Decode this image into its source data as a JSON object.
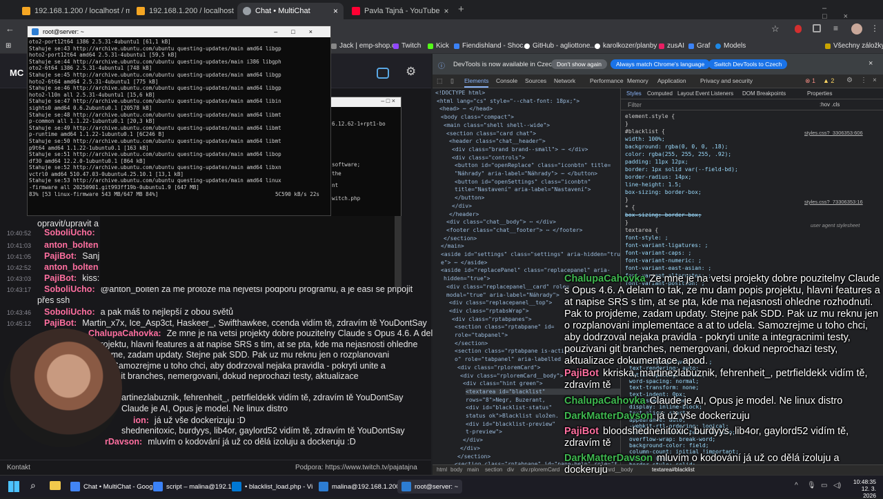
{
  "tabs": [
    {
      "label": "192.168.1.200 / localhost / mlu"
    },
    {
      "label": "192.168.1.200 / localhost / mlu"
    },
    {
      "label": "Chat • MultiChat"
    },
    {
      "label": "Pavla Tajná - YouTube"
    }
  ],
  "bookmarks": [
    "Jack | emp-shop.cz",
    "Twitch",
    "Kick",
    "Fiendishland - Shoc...",
    "GitHub - agliottone...",
    "karolkozer/planby",
    "zusAI",
    "Graf",
    "Models"
  ],
  "bookmarks_all": "Všechny záložky",
  "terminal": {
    "title": "root@server: ~",
    "lines": [
      "oto2-port12t64 i386 2.5.31-4ubuntu1 [61,1 kB]",
      "Stahuje se:43 http://archive.ubuntu.com/ubuntu questing-updates/main amd64 libgp",
      "hoto2-port12t64 amd64 2.5.31-4ubuntu1 [59,5 kB]",
      "Stahuje se:44 http://archive.ubuntu.com/ubuntu questing-updates/main i386 libgph",
      "oto2-6t64 i386 2.5.31-4ubuntu1 [748 kB]",
      "Stahuje se:45 http://archive.ubuntu.com/ubuntu questing-updates/main amd64 libgp",
      "hoto2-6t64 amd64 2.5.31-4ubuntu1 [775 kB]",
      "Stahuje se:46 http://archive.ubuntu.com/ubuntu questing-updates/main amd64 libgp",
      "hoto2-l10n all 2.5.31-4ubuntu1 [15,6 kB]",
      "Stahuje se:47 http://archive.ubuntu.com/ubuntu questing-updates/main amd64 libin",
      "sights0 amd64 0.6.2ubuntu0.1 [20578 kB]",
      "Stahuje se:48 http://archive.ubuntu.com/ubuntu questing-updates/main amd64 libmt",
      "p-common all 1.1.22-1ubuntu0.1 [20,3 kB]",
      "Stahuje se:49 http://archive.ubuntu.com/ubuntu questing-updates/main amd64 libmt",
      "p-runtime amd64 1.1.22-1ubuntu0.1 [6C246 B]",
      "Stahuje se:50 http://archive.ubuntu.com/ubuntu questing-updates/main amd64 libmt",
      "p9t64 amd64 1.1.22-1ubuntu0.1 [163 kB]",
      "Stahuje se:51 http://archive.ubuntu.com/ubuntu questing-updates/main amd64 libop",
      "df30 amd64 12.2.0-1ubuntu0.1 [864 kB]",
      "Stahuje se:52 http://archive.ubuntu.com/ubuntu questing-updates/main amd64 libxn",
      "vctrl0 amd64 510.47.03-0ubuntu4.25.10.1 [13,1 kB]",
      "Stahuje se:53 http://archive.ubuntu.com/ubuntu questing-updates/main amd64 linux",
      "-firmware all 20250901.git993ff19b-0ubuntu1.9 [647 MB]"
    ],
    "progress": "83% [53 linux-firmware 543 MB/647 MB 84%]",
    "speed": "5C590 kB/s 22s"
  },
  "term2_lines": [
    "6.12.62-1+rpt1-bo",
    "software;",
    "the",
    "nt",
    "witch.php"
  ],
  "chat": [
    {
      "time": "",
      "nick": "",
      "text": "opravit/upravit a",
      "color": "#e6e6e6"
    },
    {
      "time": "10:40:52",
      "nick": "SoboliUcho:",
      "text": "",
      "color": "#ff6fa0"
    },
    {
      "time": "10:41:03",
      "nick": "anton_bolten",
      "text": "",
      "color": "#ff6fa0"
    },
    {
      "time": "10:41:05",
      "nick": "PajiBot:",
      "text": "Sanj",
      "color": "#ff6fa0"
    },
    {
      "time": "10:42:52",
      "nick": "anton_bolten",
      "text": "",
      "color": "#ff6fa0"
    },
    {
      "time": "10:43:03",
      "nick": "PajiBot:",
      "text": "kiss:",
      "color": "#ff6fa0"
    },
    {
      "time": "10:43:17",
      "nick": "SoboliUcho:",
      "text": "@anton_bolten za mě protože má největší podporu programů, a je easí se připojit",
      "color": "#ff6fa0"
    },
    {
      "time": "",
      "nick": "",
      "text": "přes ssh",
      "color": "#e6e6e6"
    },
    {
      "time": "10:43:46",
      "nick": "SoboliUcho:",
      "text": "a pak máš to nejlepší z obou světů",
      "color": "#ff6fa0"
    },
    {
      "time": "10:45:12",
      "nick": "PajiBot:",
      "text": "Martin_x7x, Ice_Asp3ct, Haskeer_, Swifthawkee, ccenda vidím tě, zdravím tě YouDontSay",
      "color": "#ff6fa0"
    },
    {
      "time": "",
      "nick": "ChalupaCahovka:",
      "text": "Ze mne je na vetsi projekty dobre pouzitelny Claude s Opus 4.6. A delam to tak,",
      "color": "#ff6fa0"
    },
    {
      "time": "",
      "nick": "",
      "text": "is projektu, hlavni features a at napise SRS s tim, at se pta, kde ma nejasnosti ohledne",
      "color": "#e6e6e6"
    },
    {
      "time": "",
      "nick": "",
      "text": "projdeme, zadam updaty. Stejne pak SDD. Pak uz mu reknu jen o rozplanovani",
      "color": "#e6e6e6"
    },
    {
      "time": "",
      "nick": "",
      "text": "udela. Samozrejme u toho chci, aby dodrzoval nejaka pravidla - pokryti unite a",
      "color": "#e6e6e6"
    },
    {
      "time": "",
      "nick": "",
      "text": "uzivani git branches, nemergovani, dokud neprochazi testy, aktualizace",
      "color": "#e6e6e6"
    },
    {
      "time": "",
      "nick": "",
      "text": "artinezlabuznik, fehrenheit_, petrfieldekk vidím tě, zdravím tě YouDontSay",
      "color": "#e6e6e6"
    },
    {
      "time": "",
      "nick": "",
      "text": "Claude je AI, Opus je model. Ne linux distro",
      "color": "#e6e6e6"
    },
    {
      "time": "",
      "nick": "ion:",
      "text": "já už vše dockerizuju :D",
      "color": "#ff6fa0"
    },
    {
      "time": "",
      "nick": "",
      "text": "shednenitoxic, burdyys, lib4or, gaylord52 vidím tě, zdravím tě YouDontSay",
      "color": "#e6e6e6"
    },
    {
      "time": "",
      "nick": "rDavson:",
      "text": "mluvím o kodování já už co dělá izoluju a dockeruju :D",
      "color": "#ff6fa0"
    }
  ],
  "footer": {
    "left": "Kontakt",
    "right": "Podpora: https://www.twitch.tv/pajatajna"
  },
  "devtools": {
    "banner": "DevTools is now available in Czech",
    "btn_dont": "Don't show again",
    "btn_match": "Always match Chrome's language",
    "btn_switch": "Switch DevTools to Czech",
    "tabs": [
      "Elements",
      "Console",
      "Sources",
      "Network",
      "Performance",
      "Memory",
      "Application",
      "Privacy and security"
    ],
    "badges": {
      "errors": "1",
      "warnings": "2"
    },
    "subtabs": [
      "Styles",
      "Computed",
      "Layout",
      "Event Listeners",
      "DOM Breakpoints",
      "Properties"
    ],
    "filter": "Filter",
    "hov": ":hov .cls",
    "dom": [
      "<!DOCTYPE html>",
      "<html lang=\"cs\" style=\"--chat-font: 18px;\">",
      "<head> ⋯ </head>",
      "<body class=\"compact\">",
      "<main class=\"shell shell--wide\">",
      "<section class=\"card chat\">",
      "<header class=\"chat__header\">",
      "<div class=\"brand brand--small\"> ⋯ </div>",
      "<div class=\"controls\">",
      "<button id=\"openReplace\" class=\"iconbtn\" title=",
      "\"Náhrady\" aria-label=\"Náhrady\"> ⋯ </button>",
      "<button id=\"openSettings\" class=\"iconbtn\"",
      "title=\"Nastavení\" aria-label=\"Nastavení\">",
      "</button>",
      "</div>",
      "</header>",
      "<div class=\"chat__body\"> ⋯ </div>",
      "<footer class=\"chat__footer\"> ⋯ </footer>",
      "</section>",
      "</main>",
      "<aside id=\"settings\" class=\"settings\" aria-hidden=\"tru",
      "e\"> ⋯ </aside>",
      "<aside id=\"replacePanel\" class=\"replacepanel\" aria-",
      "hidden=\"true\">",
      "<div class=\"replacepanel__card\" role=",
      "modal=\"true\" aria-label=\"Náhrady\">",
      "<div class=\"replacepanel__top\">",
      "<div class=\"rptabsWrap\">",
      "<div class=\"rptabpanes\">",
      "<section class=\"rptabpane\" id=",
      "role=\"tabpanel\">",
      "</section>",
      "<section class=\"rptabpane is-active\"",
      "o\" role=\"tabpanel\" aria-labelled",
      "<div class=\"rploremCard\">",
      "<div class=\"rploremCard__body\">",
      "<div class=\"hint green\">",
      "<textarea id=\"blacklist\"",
      "rows=\"8\">Negr, Buzerant,",
      "<div id=\"blacklist-status\"",
      "status ok\">Blacklist uložen.",
      "<div id=\"blacklist-preview\"",
      "t-preview\">",
      "</div>",
      "</div>",
      "</section>",
      "<section class=\"rptabpane\" id=\"pane-help\" role=\"t"
    ],
    "styles": [
      "element.style {",
      "}",
      "#blacklist {",
      "  width: 100%;",
      "  background: rgba(0, 0, 0, .18);",
      "  color: rgba(255, 255, 255, .92);",
      "  padding: 11px 12px;",
      "  border: 1px solid var(--field-bd);",
      "  border-radius: 14px;",
      "  line-height: 1.5;",
      "  box-sizing: border-box;",
      "}",
      "* {",
      "  box-sizing: border-box;",
      "}",
      "textarea {",
      "  font-style: ;",
      "  font-variant-ligatures: ;",
      "  font-variant-caps: ;",
      "  font-variant-numeric: ;",
      "  font-variant-east-asian: ;",
      "  font-variant-alternates: ;",
      "  font-variant-position: ;"
    ],
    "style_src1": "styles.css?_3306353:606",
    "style_src2": "styles.css?_73306353:16",
    "style_ua": "user agent stylesheet",
    "styles_lower": [
      "font-language-override: ;",
      "text-rendering: auto;",
      "letter-spacing: normal;",
      "word-spacing: normal;",
      "text-transform: none;",
      "text-indent: 0px;",
      "text-shadow: none;",
      "display: inline-block;",
      "text-align: start;",
      "appearance: auto;",
      "-webkit-rtl-ordering: logical;",
      "resize: -internal-textarea-auto;",
      "overflow-wrap: break-word;",
      "background-color: field;",
      "column-count: initial !important;",
      "margin: 0em;",
      "border-style: solid;"
    ],
    "breadcrumb": [
      "html",
      "body",
      "main",
      "section",
      "div",
      "div.rploremCard",
      "div.rploremCard__body",
      "textarea#blacklist"
    ]
  },
  "overlay": [
    {
      "nick": "ChalupaCahovka",
      "text": "Ze mne je na vetsi projekty dobre pouzitelny Claude s Opus 4.6. A delam to tak, ze mu dam popis projektu, hlavni features a at napise SRS s tim, at se pta, kde ma nejasnosti ohledne rozhodnuti. Pak to projdeme, zadam updaty. Stejne pak SDD. Pak uz mu reknu jen o rozplanovani implementace a at to udela. Samozrejme u toho chci, aby dodrzoval nejaka pravidla - pokryti unite a integracnimi testy, pouzivani git branches, nemergovani, dokud neprochazi testy, aktualizace dokumentace, apod."
    },
    {
      "nick": "PajiBot",
      "text": "kkriska, martinezlabuznik, fehrenheit_, petrfieldekk vidím tě, zdravím tě"
    },
    {
      "nick": "ChalupaCahovka",
      "text": "Claude je AI, Opus je model. Ne linux distro"
    },
    {
      "nick": "DarkMatterDavson",
      "text": "já už vše dockerizuju"
    },
    {
      "nick": "PajiBot",
      "text": "bloodshednenitoxic, burdyys, lib4or, gaylord52 vidím tě, zdravím tě"
    },
    {
      "nick": "DarkMatterDavson",
      "text": "mluvím o kodování já už co dělá izoluju a dockeruju"
    }
  ],
  "taskbar": {
    "items": [
      "Chat • MultiChat - Goog",
      "script – malina@192.168",
      "• blacklist_load.php - Vi",
      "malina@192.168.1.200",
      "root@server: ~"
    ],
    "time": "10:48:35",
    "date": "12. 3. 2026"
  },
  "colors": {
    "accent": "#8ab4f8",
    "pink": "#ff6fa0",
    "green": "#3fb950",
    "bg": "#18181b"
  }
}
